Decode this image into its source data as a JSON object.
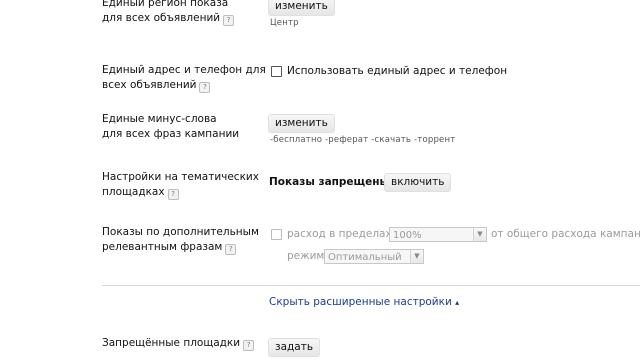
{
  "rows": {
    "region": {
      "label_line1": "Единый регион показа",
      "label_line2": "для всех объявлений",
      "help": "?",
      "button": "изменить",
      "value": "Центр"
    },
    "address": {
      "label_line1": "Единый адрес и телефон для",
      "label_line2": "всех объявлений",
      "help": "?",
      "checkbox_label": "Использовать единый адрес и телефон"
    },
    "minus_words": {
      "label_line1": "Единые минус-слова",
      "label_line2": "для всех фраз кампании",
      "button": "изменить",
      "value": "-бесплатно -реферат -скачать -торрент"
    },
    "thematic": {
      "label_line1": "Настройки на тематических",
      "label_line2": "площадках",
      "help": "?",
      "status": "Показы запрещены",
      "button": "включить"
    },
    "additional": {
      "label_line1": "Показы по дополнительным",
      "label_line2": "релевантным фразам",
      "help": "?",
      "checkbox_label": "расход в пределах",
      "percent_select": "100%",
      "suffix": "от общего расхода кампании",
      "mode_label": "режим",
      "mode_select": "Оптимальный"
    },
    "forbidden": {
      "label": "Запрещённые площадки",
      "help": "?",
      "button": "задать"
    }
  },
  "hide_advanced_link": "Скрыть расширенные настройки",
  "hide_advanced_arrow": "▴",
  "select_arrow_glyph": "▼"
}
